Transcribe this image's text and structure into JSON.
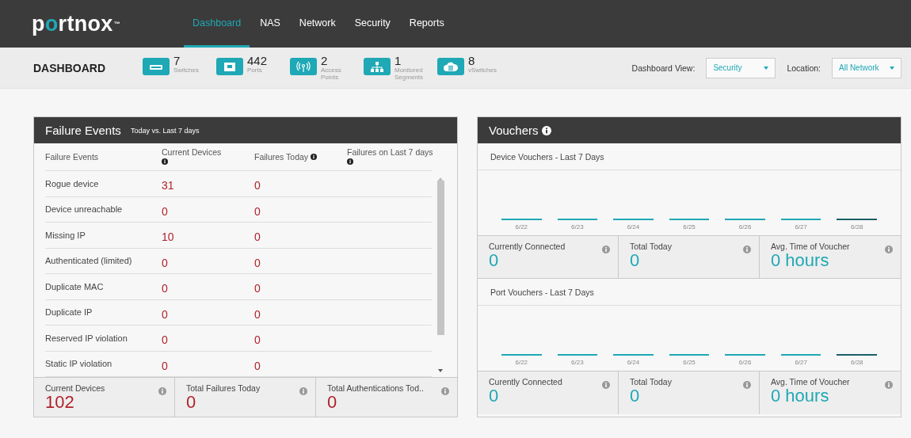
{
  "nav": {
    "logo": "portnox",
    "trademark": "™",
    "items": [
      {
        "label": "Dashboard",
        "selected": true
      },
      {
        "label": "NAS",
        "selected": false
      },
      {
        "label": "Network",
        "selected": false
      },
      {
        "label": "Security",
        "selected": false
      },
      {
        "label": "Reports",
        "selected": false
      }
    ]
  },
  "header": {
    "title": "DASHBOARD",
    "stats": [
      {
        "kind": "switch",
        "value": "7",
        "label": "Switches"
      },
      {
        "kind": "port",
        "value": "442",
        "label": "Ports"
      },
      {
        "kind": "access-point",
        "value": "2",
        "label": "Access Points"
      },
      {
        "kind": "segments",
        "value": "1",
        "label": "Monitored Segments"
      },
      {
        "kind": "cloud",
        "value": "8",
        "label": "vSwitches"
      }
    ],
    "filters": [
      {
        "label": "Dashboard View:",
        "value": "Security"
      },
      {
        "label": "Location:",
        "value": "All Network"
      }
    ]
  },
  "failure_events": {
    "title": "Failure Events",
    "subtitle": "Today vs. Last 7 days",
    "columns": [
      {
        "label": "Failure Events",
        "info": false
      },
      {
        "label": "Current Devices",
        "info": true
      },
      {
        "label": "Failures Today",
        "info": true
      },
      {
        "label": "Failures on Last 7 days",
        "info": true
      }
    ],
    "rows": [
      {
        "event": "Rogue device",
        "current": "31",
        "today": "0"
      },
      {
        "event": "Device unreachable",
        "current": "0",
        "today": "0"
      },
      {
        "event": "Missing IP",
        "current": "10",
        "today": "0"
      },
      {
        "event": "Authenticated (limited)",
        "current": "0",
        "today": "0"
      },
      {
        "event": "Duplicate MAC",
        "current": "0",
        "today": "0"
      },
      {
        "event": "Duplicate IP",
        "current": "0",
        "today": "0"
      },
      {
        "event": "Reserved IP violation",
        "current": "0",
        "today": "0"
      },
      {
        "event": "Static IP violation",
        "current": "0",
        "today": "0"
      }
    ],
    "totals": [
      {
        "label": "Current Devices",
        "value": "102"
      },
      {
        "label": "Total Failures Today",
        "value": "0"
      },
      {
        "label": "Total Authentications Tod..",
        "value": "0"
      }
    ]
  },
  "vouchers": {
    "title": "Vouchers",
    "sections": [
      {
        "title": "Device Vouchers - Last 7 Days",
        "days": [
          {
            "label": "6/22",
            "selected": false
          },
          {
            "label": "6/23",
            "selected": false
          },
          {
            "label": "6/24",
            "selected": false
          },
          {
            "label": "6/25",
            "selected": false
          },
          {
            "label": "6/26",
            "selected": false
          },
          {
            "label": "6/27",
            "selected": false
          },
          {
            "label": "6/28",
            "selected": true
          }
        ],
        "stats": [
          {
            "label": "Currently Connected",
            "value": "0"
          },
          {
            "label": "Total Today",
            "value": "0"
          },
          {
            "label": "Avg. Time of Voucher",
            "value": "0 hours"
          }
        ]
      },
      {
        "title": "Port Vouchers - Last 7 Days",
        "days": [
          {
            "label": "6/22",
            "selected": false
          },
          {
            "label": "6/23",
            "selected": false
          },
          {
            "label": "6/24",
            "selected": false
          },
          {
            "label": "6/25",
            "selected": false
          },
          {
            "label": "6/26",
            "selected": false
          },
          {
            "label": "6/27",
            "selected": false
          },
          {
            "label": "6/28",
            "selected": true
          }
        ],
        "stats": [
          {
            "label": "Curently Connected",
            "value": "0"
          },
          {
            "label": "Total Today",
            "value": "0"
          },
          {
            "label": "Avg. Time of Voucher",
            "value": "0 hours"
          }
        ]
      }
    ]
  }
}
